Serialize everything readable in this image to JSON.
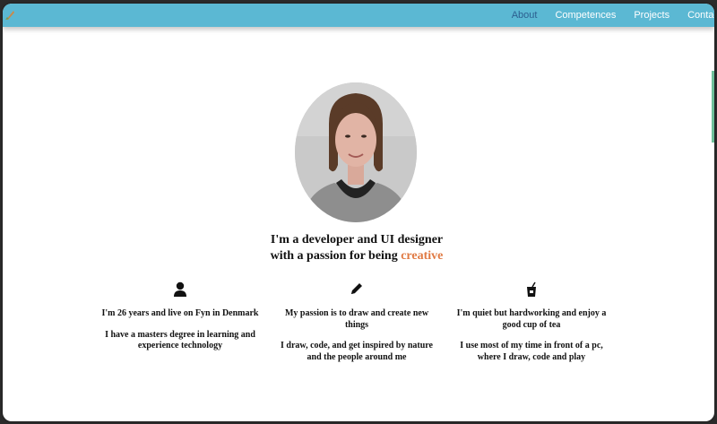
{
  "nav": {
    "items": [
      "About",
      "Competences",
      "Projects",
      "Contact"
    ],
    "active": "About"
  },
  "intro": {
    "line1": "I'm a developer and UI designer",
    "line2_prefix": "with a passion for being",
    "line2_accent": "creative"
  },
  "columns": [
    {
      "icon": "person-icon",
      "p1": "I'm 26 years and live on Fyn in Denmark",
      "p2": "I have a masters degree in learning and experience technology"
    },
    {
      "icon": "pencil-icon",
      "p1": "My passion is to draw and create new things",
      "p2": "I draw, code, and get inspired by nature and the people around me"
    },
    {
      "icon": "tea-cup-icon",
      "p1": "I'm quiet but hardworking and enjoy a good cup of tea",
      "p2": "I use most of my time in front of a pc, where I draw, code and play"
    }
  ],
  "colors": {
    "navbar": "#5bb8d3",
    "active_nav": "#2c5f90",
    "accent": "#e07a43"
  }
}
